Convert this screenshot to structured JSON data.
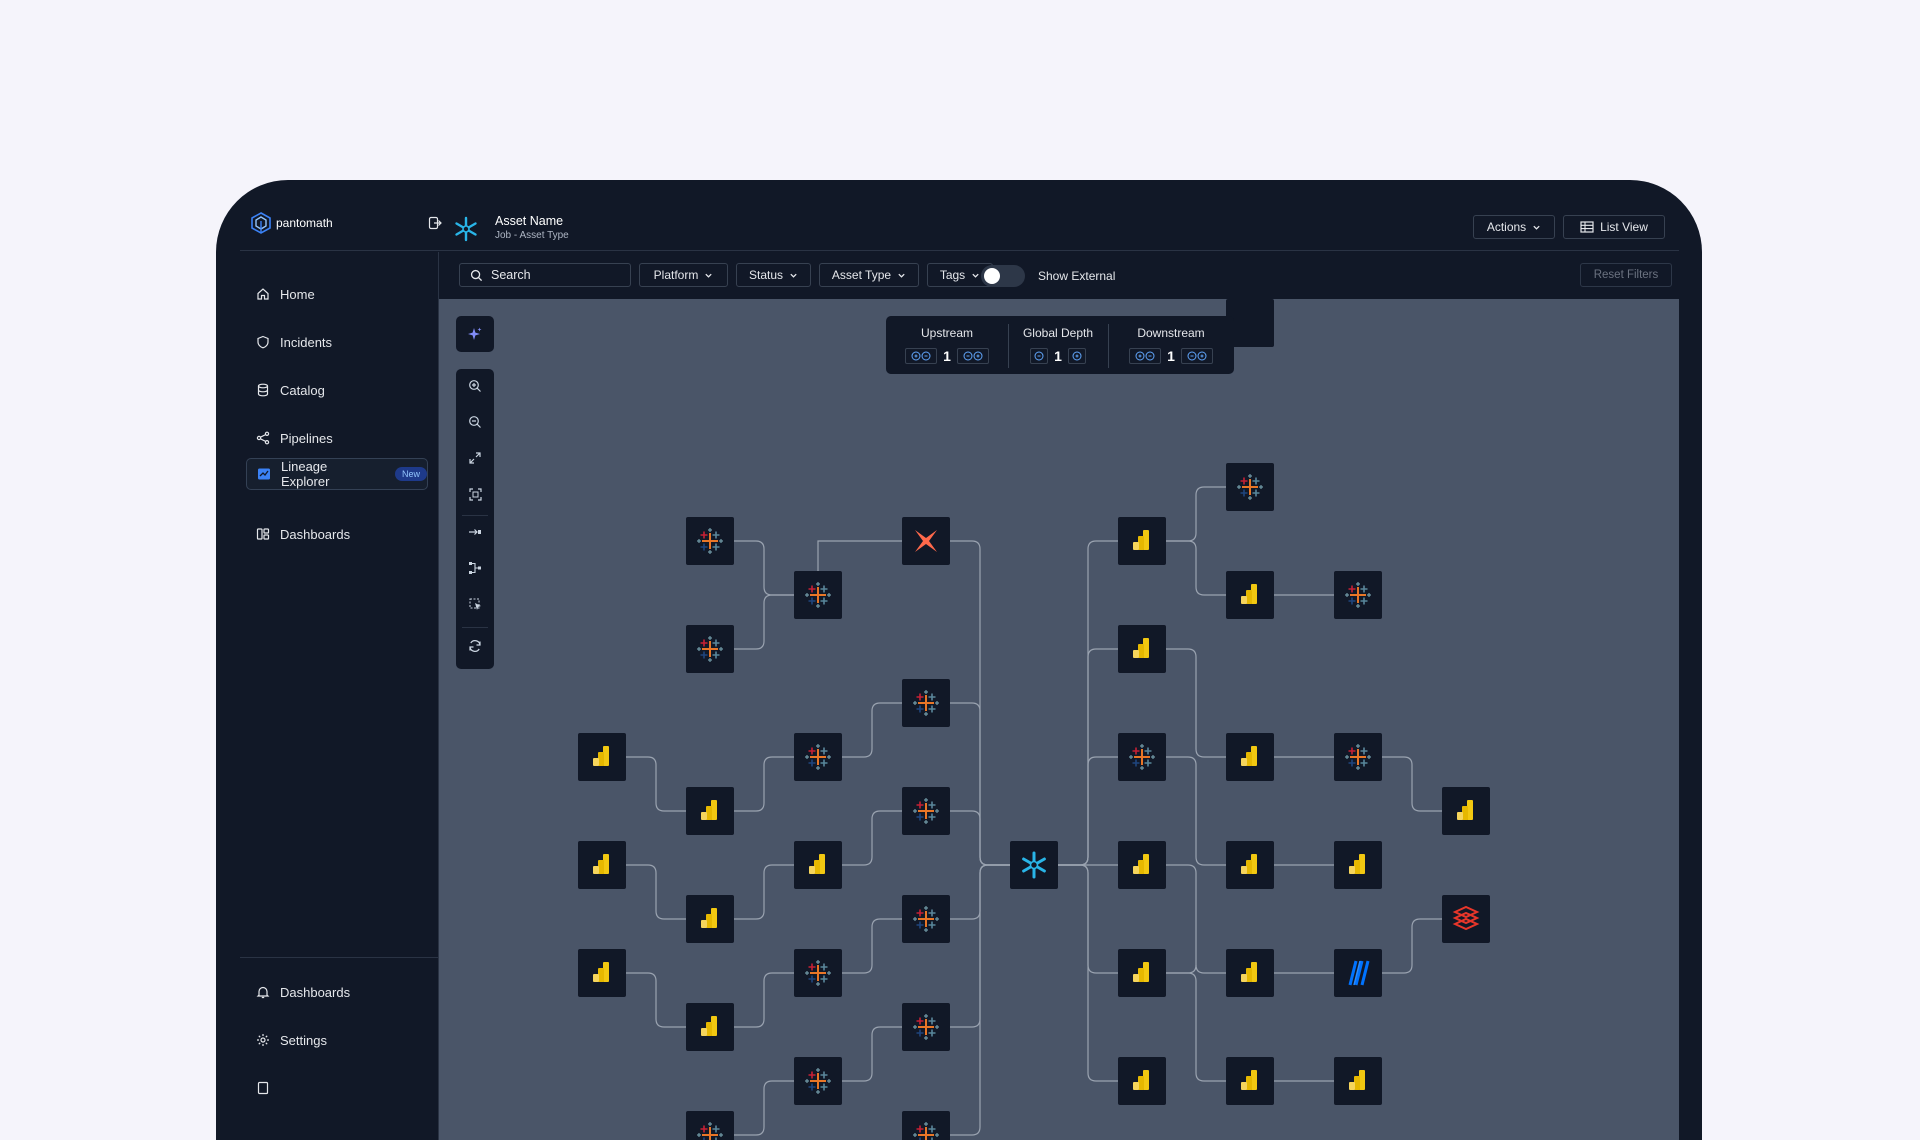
{
  "brand": {
    "name": "pantomath"
  },
  "sidebar": {
    "items": [
      {
        "label": "Home",
        "icon": "home-icon"
      },
      {
        "label": "Incidents",
        "icon": "shield-icon"
      },
      {
        "label": "Catalog",
        "icon": "database-icon"
      },
      {
        "label": "Pipelines",
        "icon": "share-icon"
      },
      {
        "label": "Lineage Explorer",
        "icon": "lineage-icon",
        "badge": "New",
        "active": true
      },
      {
        "label": "Dashboards",
        "icon": "dashboard-icon"
      }
    ],
    "bottom_items": [
      {
        "label": "Dashboards",
        "icon": "bell-icon"
      },
      {
        "label": "Settings",
        "icon": "gear-icon"
      }
    ]
  },
  "header": {
    "asset_name": "Asset Name",
    "asset_subtitle": "Job - Asset Type",
    "actions_label": "Actions",
    "list_view_label": "List View"
  },
  "filters": {
    "search_placeholder": "Search",
    "platform": "Platform",
    "status": "Status",
    "asset_type": "Asset Type",
    "tags": "Tags",
    "show_external": "Show External",
    "show_external_on": false,
    "reset": "Reset Filters"
  },
  "depth": {
    "upstream_label": "Upstream",
    "upstream_value": "1",
    "global_label": "Global Depth",
    "global_value": "1",
    "downstream_label": "Downstream",
    "downstream_value": "1"
  },
  "colors": {
    "page_bg": "#f5f4fb",
    "app_bg": "#111827",
    "canvas_bg": "#4a5568",
    "accent_blue": "#3b82f6",
    "powerbi_yellow": "#f2c811",
    "snowflake_blue": "#29b5e8",
    "dbt_orange": "#ff694b",
    "databricks_red": "#e8362a"
  },
  "lineage": {
    "node_types": [
      "tableau",
      "powerbi",
      "snowflake",
      "dbt",
      "databricks",
      "fivetran"
    ],
    "root": "snowflake"
  }
}
